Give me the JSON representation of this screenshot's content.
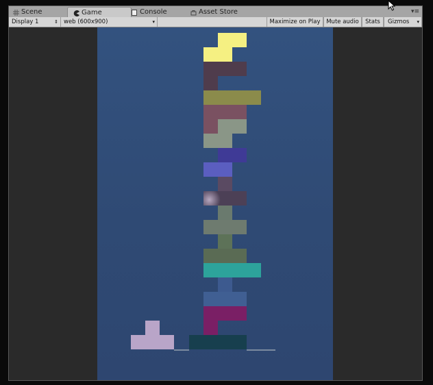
{
  "tabs": [
    {
      "label": "Scene",
      "icon": "grid-icon"
    },
    {
      "label": "Game",
      "icon": "pacman-icon"
    },
    {
      "label": "Console",
      "icon": "console-icon"
    },
    {
      "label": "Asset Store",
      "icon": "store-icon"
    }
  ],
  "toolbar": {
    "display": "Display 1",
    "resolution": "web (600x900)",
    "maximize": "Maximize on Play",
    "mute": "Mute audio",
    "stats": "Stats",
    "gizmos": "Gizmos"
  },
  "colors": {
    "background": "#33527f",
    "pieces": [
      "#f5f082",
      "#4f3c4c",
      "#8b8b4b",
      "#7a5161",
      "#8a9687",
      "#46439e",
      "#4c4056",
      "#6e7b6f",
      "#5a6b54",
      "#2da39b",
      "#3d5a8f",
      "#7a1f65",
      "#173f4e",
      "#b9a5c8"
    ]
  }
}
